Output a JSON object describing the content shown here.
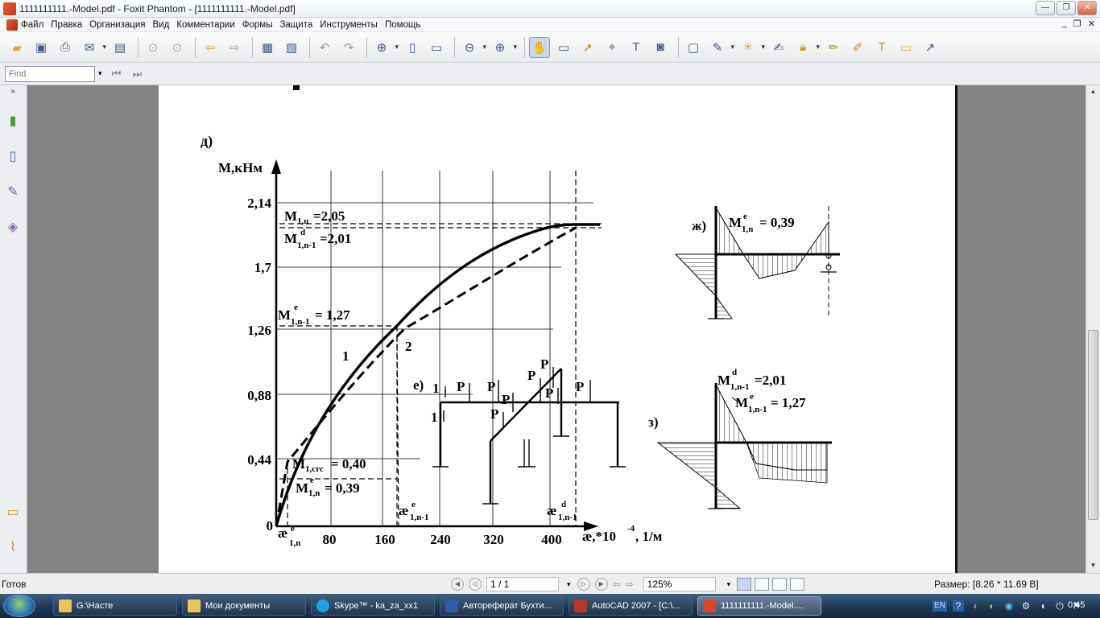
{
  "window": {
    "title": "1111111111.-Model.pdf - Foxit Phantom - [1111111111.-Model.pdf]",
    "controls": {
      "minimize": "—",
      "maximize": "❐",
      "close": "✕"
    },
    "mdi_controls": {
      "minimize": "_",
      "restore": "❐",
      "close": "✕"
    }
  },
  "menu": {
    "items": [
      "Файл",
      "Правка",
      "Организация",
      "Вид",
      "Комментарии",
      "Формы",
      "Защита",
      "Инструменты",
      "Помощь"
    ]
  },
  "findbar": {
    "placeholder": "Find"
  },
  "drawing": {
    "section_d": "д)",
    "y_axis_label": "М,кНм",
    "y_ticks": [
      "2,14",
      "1,7",
      "1,26",
      "0,88",
      "0,44",
      "0"
    ],
    "x_ticks": [
      "80",
      "160",
      "240",
      "320",
      "400"
    ],
    "x_axis_label": "æ,*10",
    "x_axis_exp": "-4",
    "x_axis_unit": ", 1/м",
    "ann_m1u": "М",
    "ann_m1u_sub": "1,u",
    "ann_m1u_val": "=2,05",
    "ann_md": "М",
    "ann_md_sup": "d",
    "ann_md_sub": "1,n-1",
    "ann_md_val": "=2,01",
    "ann_me": "М",
    "ann_me_sup": "e",
    "ann_me_sub": "1,n-1",
    "ann_me_val": "= 1,27",
    "curve1": "1",
    "curve2": "2",
    "ann_mcrc": "М",
    "ann_mcrc_sub": "1,crc",
    "ann_mcrc_val": "= 0,40",
    "ann_m1n": "М",
    "ann_m1n_sup": "e",
    "ann_m1n_sub": "1,n",
    "ann_m1n_val": "= 0,39",
    "kappa_e1n": "æ",
    "kappa_e1n_sup": "e",
    "kappa_e1n_sub": "1,n",
    "kappa_en1": "æ",
    "kappa_en1_sup": "e",
    "kappa_en1_sub": "1,n-1",
    "kappa_dn1": "æ",
    "kappa_dn1_sup": "d",
    "kappa_dn1_sub": "1,n-1",
    "section_e": "е)",
    "frame_label_1a": "1",
    "frame_label_1b": "1",
    "load_p": "P",
    "section_zh": "ж)",
    "zh_label": "М",
    "zh_sup": "e",
    "zh_sub": "1,n",
    "zh_val": "= 0,39",
    "section_z": "з)",
    "z_label1": "М",
    "z_sup1": "d",
    "z_sub1": "1,n-1",
    "z_val1": "=2,01",
    "z_label2": "М",
    "z_sup2": "e",
    "z_sub2": "1,n-1",
    "z_val2": "= 1,27"
  },
  "status": {
    "ready": "Готов",
    "page": "1 / 1",
    "zoom": "125%",
    "size": "Размер: [8.26 * 11.69 B]"
  },
  "taskbar": {
    "tasks": [
      "G:\\Насте",
      "Мои документы",
      "Skype™ - ka_za_xx1",
      "Автореферат Бухти...",
      "AutoCAD 2007 - [C:\\...",
      "1111111111.-Model...."
    ],
    "lang": "EN",
    "clock": "0:45"
  }
}
